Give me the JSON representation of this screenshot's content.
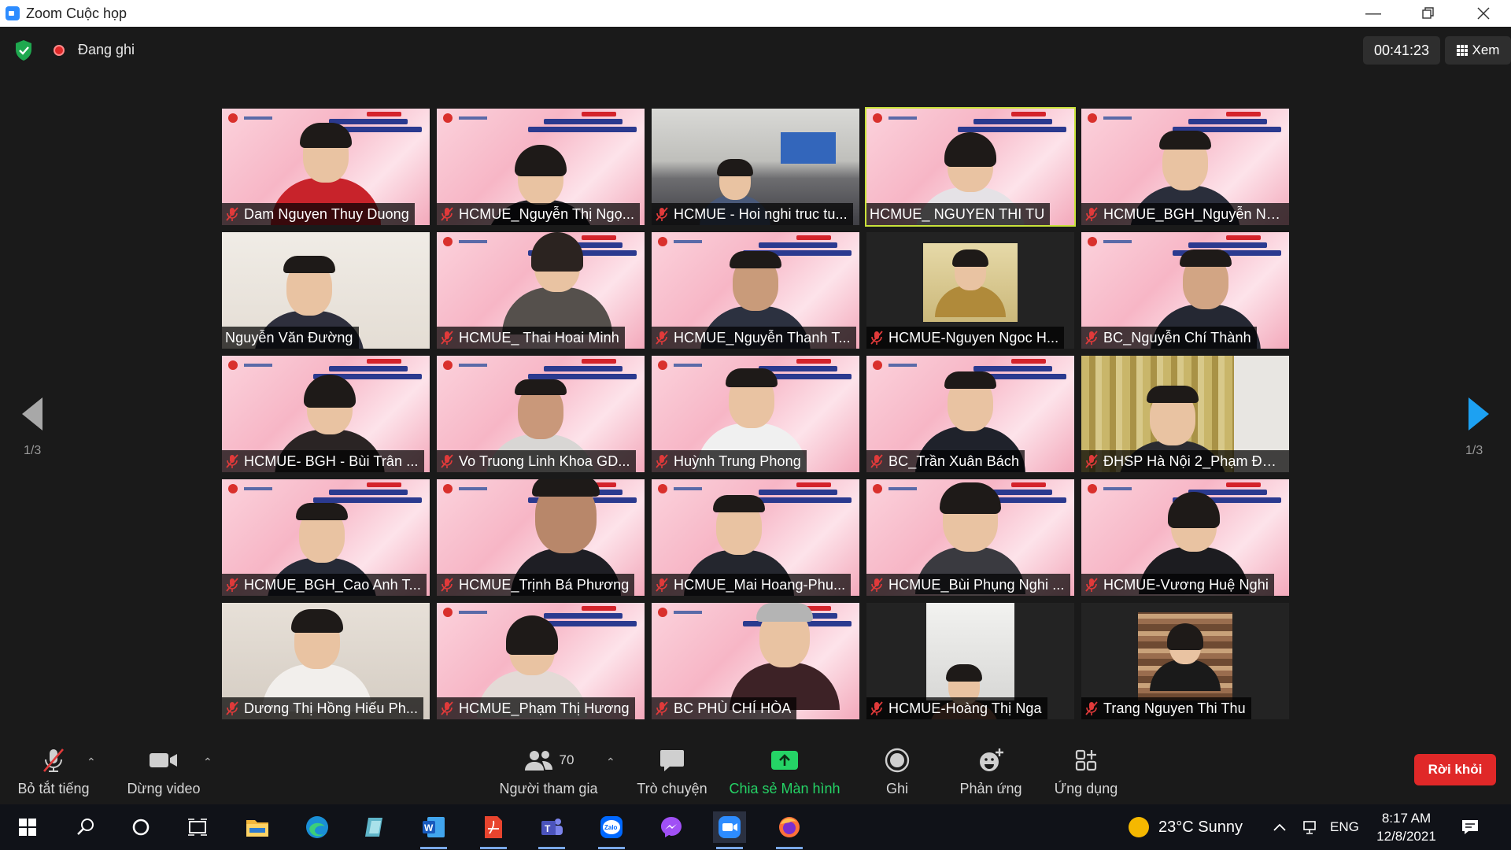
{
  "window": {
    "title": "Zoom Cuộc họp"
  },
  "topbar": {
    "recording_label": "Đang ghi",
    "timer": "00:41:23",
    "view_label": "Xem"
  },
  "paging": {
    "left": "1/3",
    "right": "1/3"
  },
  "participants": [
    {
      "name": "Dam Nguyen Thuy Duong",
      "muted": true
    },
    {
      "name": "HCMUE_Nguyễn Thị Ngọ...",
      "muted": true
    },
    {
      "name": "HCMUE - Hoi nghi truc tu...",
      "muted": true
    },
    {
      "name": "HCMUE_ NGUYEN THI TU",
      "muted": false,
      "active": true
    },
    {
      "name": "HCMUE_BGH_Nguyễn Ng...",
      "muted": true
    },
    {
      "name": "Nguyễn Văn Đường",
      "muted": false
    },
    {
      "name": "HCMUE_ Thai Hoai Minh",
      "muted": true
    },
    {
      "name": "HCMUE_Nguyễn Thanh T...",
      "muted": true
    },
    {
      "name": "HCMUE-Nguyen Ngoc H...",
      "muted": true
    },
    {
      "name": "BC_Nguyễn Chí Thành",
      "muted": true
    },
    {
      "name": "HCMUE- BGH - Bùi Trân ...",
      "muted": true
    },
    {
      "name": "Vo Truong Linh Khoa GD...",
      "muted": true
    },
    {
      "name": "Huỳnh Trung Phong",
      "muted": true
    },
    {
      "name": "BC_Trần Xuân Bách",
      "muted": true
    },
    {
      "name": "ĐHSP Hà Nội 2_Phạm Đứ...",
      "muted": true
    },
    {
      "name": "HCMUE_BGH_Cao Anh T...",
      "muted": true
    },
    {
      "name": "HCMUE_Trịnh Bá Phương",
      "muted": true
    },
    {
      "name": "HCMUE_Mai Hoang-Phu...",
      "muted": true
    },
    {
      "name": "HCMUE_Bùi Phụng Nghi ...",
      "muted": true
    },
    {
      "name": "HCMUE-Vương Huệ Nghi",
      "muted": true
    },
    {
      "name": "Dương Thị Hồng Hiếu Ph...",
      "muted": true
    },
    {
      "name": "HCMUE_Phạm Thị Hương",
      "muted": true
    },
    {
      "name": "BC PHÙ  CHÍ  HÒA",
      "muted": true
    },
    {
      "name": "HCMUE-Hoàng Thị Nga",
      "muted": true
    },
    {
      "name": "Trang Nguyen Thi Thu",
      "muted": true
    }
  ],
  "toolbar": {
    "mute_label": "Bỏ tắt tiếng",
    "video_label": "Dừng video",
    "participants_label": "Người tham gia",
    "participants_count": "70",
    "chat_label": "Trò chuyện",
    "share_label": "Chia sẻ Màn hình",
    "record_label": "Ghi",
    "reactions_label": "Phản ứng",
    "apps_label": "Ứng dụng",
    "leave_label": "Rời khỏi"
  },
  "taskbar": {
    "weather": "23°C  Sunny",
    "language": "ENG",
    "time": "8:17 AM",
    "date": "12/8/2021"
  },
  "colors": {
    "share_green": "#25d366",
    "leave_red": "#e02828",
    "active_border": "#c9e23a",
    "next_arrow": "#1da1f2"
  }
}
